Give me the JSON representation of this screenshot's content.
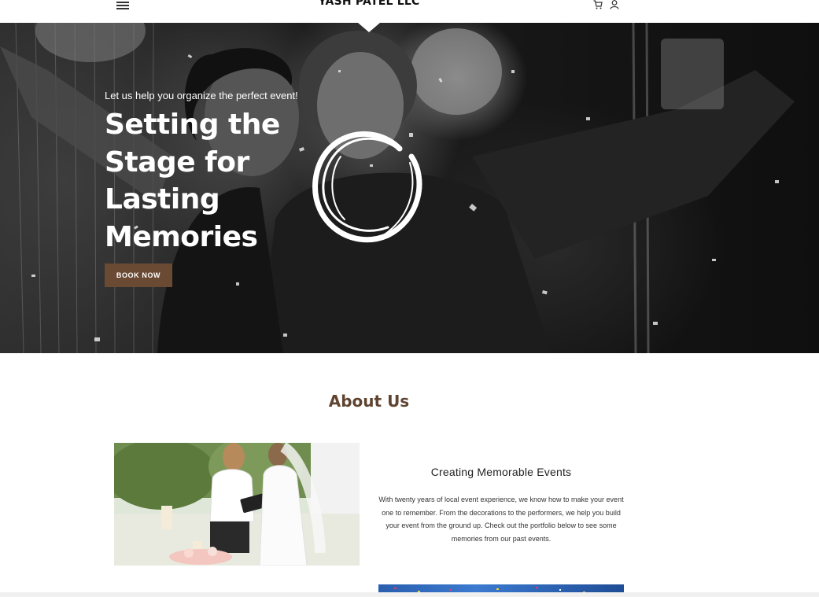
{
  "header": {
    "logo": "YASH PATEL LLC",
    "menu_icon": "hamburger-menu-icon",
    "cart_icon": "cart-icon",
    "account_icon": "user-icon"
  },
  "hero": {
    "tagline": "Let us help you organize the perfect event!",
    "title": "Setting the Stage for Lasting Memories",
    "button_label": "BOOK NOW",
    "button_color": "#6b4a33"
  },
  "about": {
    "heading": "About Us",
    "heading_color": "#5f4431",
    "card_title": "Creating Memorable Events",
    "card_text": "With twenty years of local event experience, we know how to make your event one to remember. From the decorations to the performers, we help you build your event from the ground up. Check out the portfolio below to see some memories from our past events."
  }
}
